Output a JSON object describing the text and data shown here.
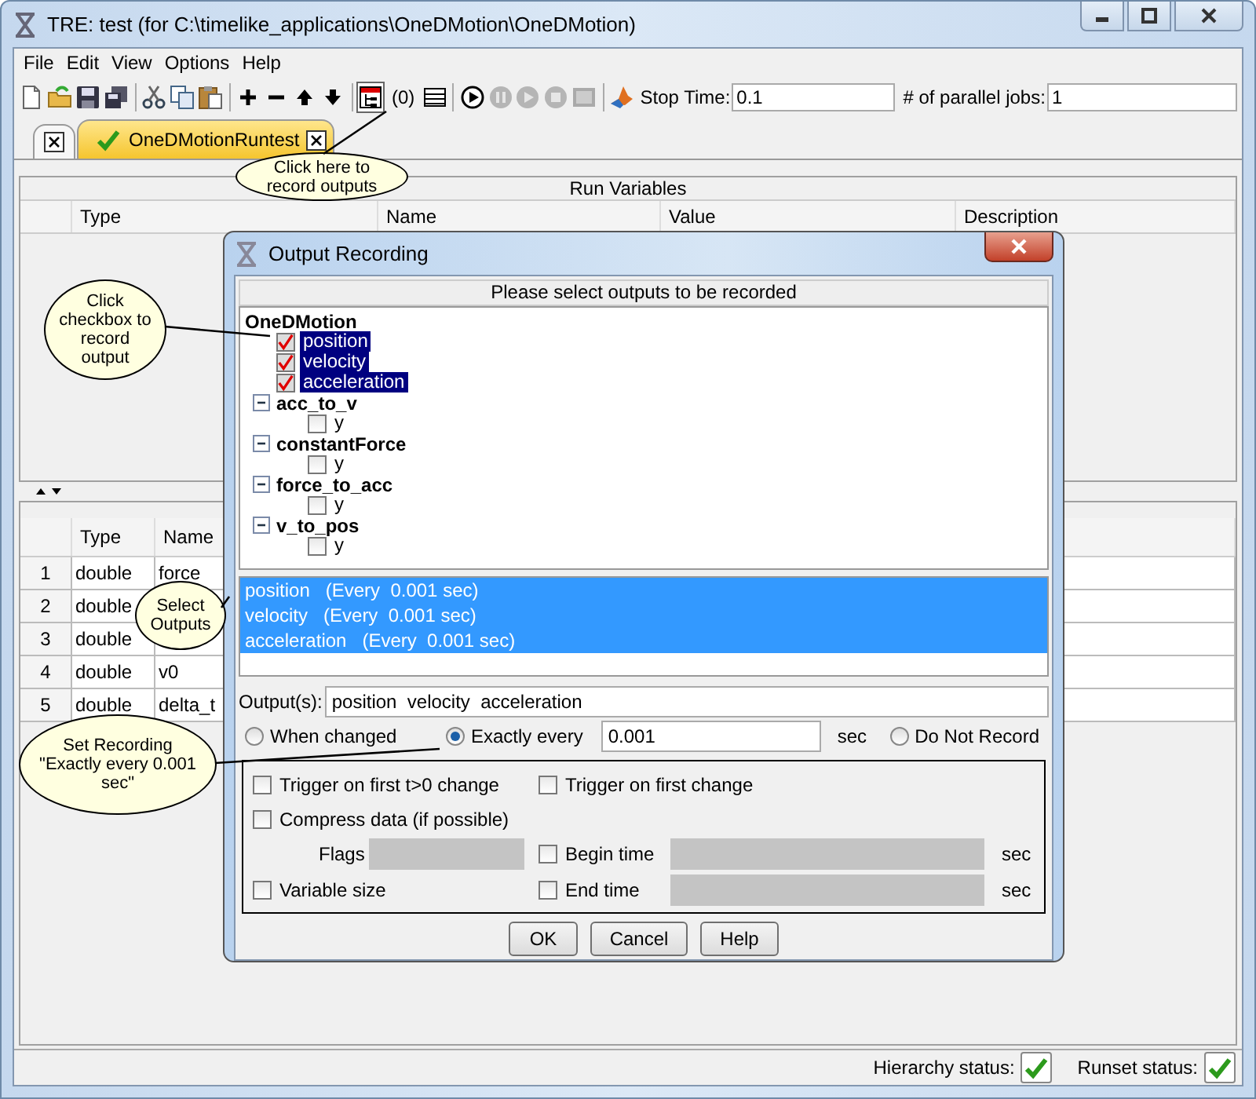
{
  "window": {
    "title": "TRE:  test (for C:\\timelike_applications\\OneDMotion\\OneDMotion)"
  },
  "menu": [
    "File",
    "Edit",
    "View",
    "Options",
    "Help"
  ],
  "toolbar": {
    "record_count": "(0)",
    "run_controls": [
      {
        "disabled": false
      },
      {
        "disabled": true
      },
      {
        "disabled": true
      },
      {
        "disabled": true
      },
      {
        "disabled": true
      }
    ],
    "stop_time": {
      "label": "Stop Time:",
      "value": "0.1"
    },
    "parallel_jobs": {
      "label": "# of parallel jobs:",
      "value": "1"
    }
  },
  "tabs": [
    {
      "selected": false
    },
    {
      "label": "OneDMotionRuntest",
      "selected": true
    }
  ],
  "run_variables": {
    "title": "Run Variables",
    "columns": [
      "Type",
      "Name",
      "Value",
      "Description"
    ]
  },
  "variables_table": {
    "columns": [
      "Type",
      "Name"
    ],
    "rows": [
      {
        "index": "1",
        "type": "double",
        "name": "force"
      },
      {
        "index": "2",
        "type": "double"
      },
      {
        "index": "3",
        "type": "double"
      },
      {
        "index": "4",
        "type": "double",
        "name": "v0"
      },
      {
        "index": "5",
        "type": "double",
        "name": "delta_t"
      }
    ]
  },
  "status_bar": [
    {
      "label": "Hierarchy status:",
      "ok": true
    },
    {
      "label": "Runset status:",
      "ok": true
    }
  ],
  "dialog": {
    "title": "Output Recording",
    "heading": "Please select outputs to be recorded",
    "tree": {
      "label": "OneDMotion",
      "children": [
        {
          "kind": "leaf",
          "label": "position",
          "checked": true,
          "selected": true
        },
        {
          "kind": "leaf",
          "label": "velocity",
          "checked": true,
          "selected": true
        },
        {
          "kind": "leaf",
          "label": "acceleration",
          "checked": true,
          "selected": true
        },
        {
          "kind": "group",
          "label": "acc_to_v",
          "expanded": true,
          "children": [
            {
              "kind": "leaf",
              "label": "y",
              "checked": false,
              "selected": false
            }
          ]
        },
        {
          "kind": "group",
          "label": "constantForce",
          "expanded": true,
          "children": [
            {
              "kind": "leaf",
              "label": "y",
              "checked": false,
              "selected": false
            }
          ]
        },
        {
          "kind": "group",
          "label": "force_to_acc",
          "expanded": true,
          "children": [
            {
              "kind": "leaf",
              "label": "y",
              "checked": false,
              "selected": false
            }
          ]
        },
        {
          "kind": "group",
          "label": "v_to_pos",
          "expanded": true,
          "children": [
            {
              "kind": "leaf",
              "label": "y",
              "checked": false,
              "selected": false
            }
          ]
        }
      ]
    },
    "selected_outputs": [
      {
        "text": "position   (Every  0.001 sec)",
        "selected": true
      },
      {
        "text": "velocity   (Every  0.001 sec)",
        "selected": true
      },
      {
        "text": "acceleration   (Every  0.001 sec)",
        "selected": true
      }
    ],
    "outputs_field": {
      "label": "Output(s):",
      "value": "position  velocity  acceleration"
    },
    "record_modes": [
      {
        "label": "When changed",
        "selected": false
      },
      {
        "label": "Exactly every",
        "selected": true,
        "value": "0.001",
        "unit": "sec"
      },
      {
        "label": "Do Not Record",
        "selected": false
      }
    ],
    "options": {
      "trigger_positive": {
        "label": "Trigger on first t>0 change",
        "checked": false
      },
      "trigger_first": {
        "label": "Trigger on first change",
        "checked": false
      },
      "compress": {
        "label": "Compress data (if possible)",
        "checked": false
      },
      "flags": {
        "label": "Flags",
        "disabled": true
      },
      "begin_time": {
        "label": "Begin time",
        "checked": false,
        "disabled": true,
        "unit": "sec"
      },
      "variable_size": {
        "label": "Variable size",
        "checked": false
      },
      "end_time": {
        "label": "End time",
        "checked": false,
        "disabled": true,
        "unit": "sec"
      }
    },
    "buttons": [
      "OK",
      "Cancel",
      "Help"
    ]
  },
  "callouts": [
    {
      "text": "Click here to record outputs"
    },
    {
      "text": "Click checkbox to record output"
    },
    {
      "text": "Select Outputs"
    },
    {
      "text": "Set Recording \"Exactly every 0.001 sec\""
    }
  ]
}
